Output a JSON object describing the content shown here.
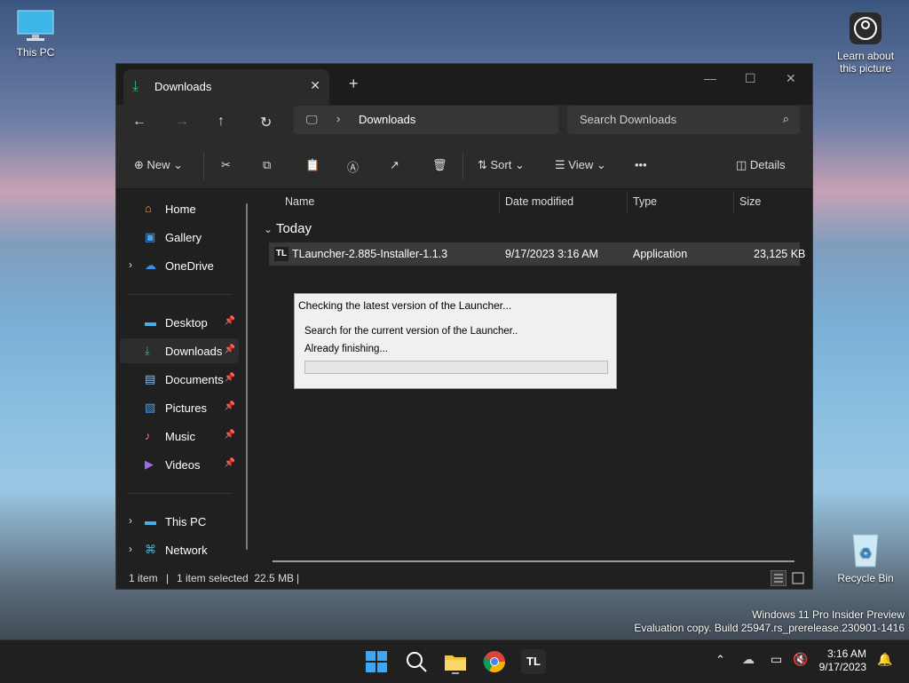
{
  "desktop": {
    "this_pc_label": "This PC",
    "learn_label_1": "Learn about",
    "learn_label_2": "this picture",
    "recycle_label": "Recycle Bin",
    "watermark_line1": "Windows 11 Pro Insider Preview",
    "watermark_line2": "Evaluation copy. Build 25947.rs_prerelease.230901-1416"
  },
  "explorer": {
    "tab_title": "Downloads",
    "address": "Downloads",
    "search_placeholder": "Search Downloads",
    "toolbar": {
      "new_label": "New",
      "sort_label": "Sort",
      "view_label": "View",
      "more_label": "•••",
      "details_label": "Details"
    },
    "sidebar": {
      "home": "Home",
      "gallery": "Gallery",
      "onedrive": "OneDrive",
      "desktop": "Desktop",
      "downloads": "Downloads",
      "documents": "Documents",
      "pictures": "Pictures",
      "music": "Music",
      "videos": "Videos",
      "this_pc": "This PC",
      "network": "Network"
    },
    "columns": {
      "name": "Name",
      "date": "Date modified",
      "type": "Type",
      "size": "Size"
    },
    "group_label": "Today",
    "files": [
      {
        "name": "TLauncher-2.885-Installer-1.1.3",
        "date": "9/17/2023 3:16 AM",
        "type": "Application",
        "size": "23,125 KB"
      }
    ],
    "status": {
      "count": "1 item",
      "selected": "1 item selected  22.5 MB"
    }
  },
  "dialog": {
    "title": "Checking the latest version of the Launcher...",
    "line1": "Search for the current version of the Launcher..",
    "line2": "Already finishing...",
    "progress": 0
  },
  "taskbar": {
    "time": "3:16 AM",
    "date": "9/17/2023",
    "tl_label": "TL"
  }
}
